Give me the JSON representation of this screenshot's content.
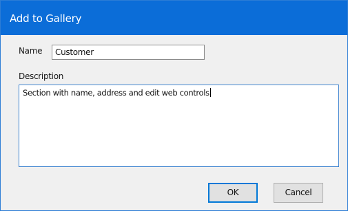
{
  "window": {
    "title": "Add to Gallery"
  },
  "form": {
    "name_label": "Name",
    "name_value": "Customer",
    "description_label": "Description",
    "description_value": "Section with name, address and edit web controls"
  },
  "buttons": {
    "ok_label": "OK",
    "cancel_label": "Cancel"
  },
  "colors": {
    "titlebar": "#0b6dd8",
    "dialog_bg": "#f0f0f0",
    "focus_border": "#0078d7"
  }
}
